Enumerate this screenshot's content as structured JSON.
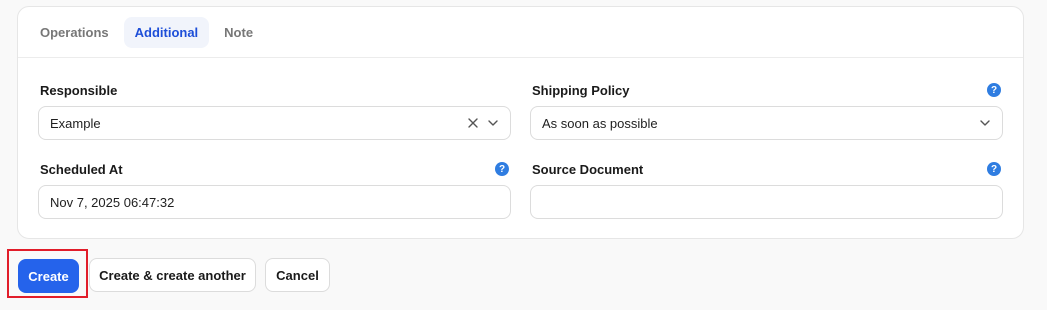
{
  "tabs": [
    "Operations",
    "Additional",
    "Note"
  ],
  "active_tab": "Additional",
  "fields": {
    "responsible": {
      "label": "Responsible",
      "value": "Example"
    },
    "shipping_policy": {
      "label": "Shipping Policy",
      "value": "As soon as possible",
      "help": "?"
    },
    "scheduled_at": {
      "label": "Scheduled At",
      "value": "Nov 7, 2025 06:47:32",
      "help": "?"
    },
    "source_document": {
      "label": "Source Document",
      "value": "",
      "help": "?"
    }
  },
  "actions": {
    "create": "Create",
    "create_another": "Create & create another",
    "cancel": "Cancel"
  },
  "colors": {
    "accent": "#2563eb",
    "help_icon": "#2f7de1",
    "highlight": "#e11d2a"
  }
}
